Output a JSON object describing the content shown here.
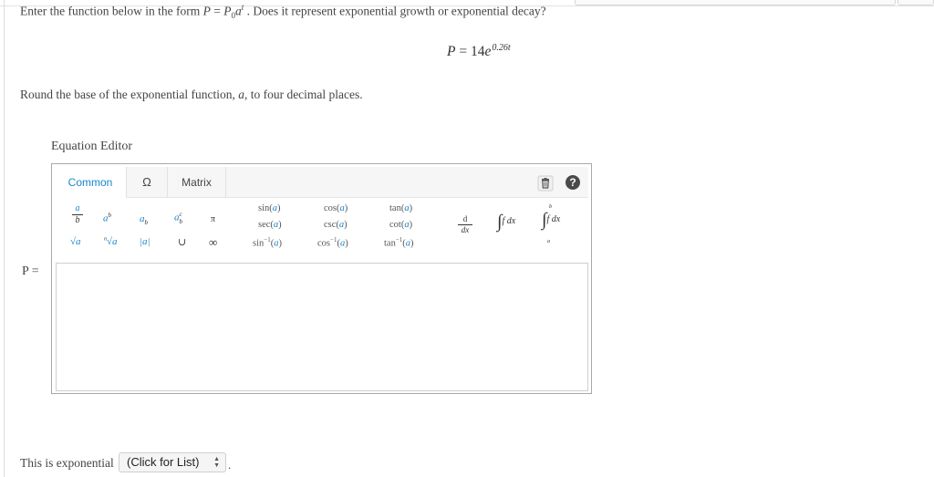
{
  "question": {
    "prompt_before": "Enter the function below in the form ",
    "prompt_form_lhs": "P",
    "prompt_form_rhs": "P",
    "prompt_form_sub": "0",
    "prompt_form_base": "a",
    "prompt_form_exp": "t",
    "prompt_after": " . Does it represent exponential growth or exponential decay?",
    "given_lhs": "P",
    "given_coeff": "14",
    "given_base": "e",
    "given_exponent": "0.26t",
    "round_before": "Round the base of the exponential function, ",
    "round_var": "a",
    "round_after": ", to four decimal places."
  },
  "editor": {
    "label": "Equation Editor",
    "tabs": [
      {
        "label": "Common",
        "active": true
      },
      {
        "label": "Ω",
        "active": false
      },
      {
        "label": "Matrix",
        "active": false
      }
    ],
    "help_label": "?",
    "palette": {
      "frac_num": "a",
      "frac_den": "b",
      "power_base": "a",
      "power_exp": "b",
      "sub_base": "a",
      "sub_idx": "b",
      "subsup_base": "a",
      "subsup_sup": "c",
      "subsup_sub": "b",
      "pi": "π",
      "sqrt": "√a",
      "nroot_idx": "n",
      "nroot_body": "√a",
      "abs": "|a|",
      "union": "∪",
      "infinity": "∞",
      "sin": "sin",
      "cos": "cos",
      "tan": "tan",
      "sec": "sec",
      "csc": "csc",
      "cot": "cot",
      "arcsin": "sin",
      "arccos": "cos",
      "arctan": "tan",
      "inv_sup": "−1",
      "arg": "a",
      "deriv_num": "d",
      "deriv_den": "dx",
      "integral_body": "f dx",
      "defint_upper": "b",
      "defint_lower": "a",
      "defint_body": "f dx"
    }
  },
  "answer": {
    "label": "P ="
  },
  "classification": {
    "before": "This is exponential",
    "select_value": "(Click for List)",
    "after": "."
  },
  "colors": {
    "accent": "#1a86c9",
    "border": "#a9a9a9"
  }
}
